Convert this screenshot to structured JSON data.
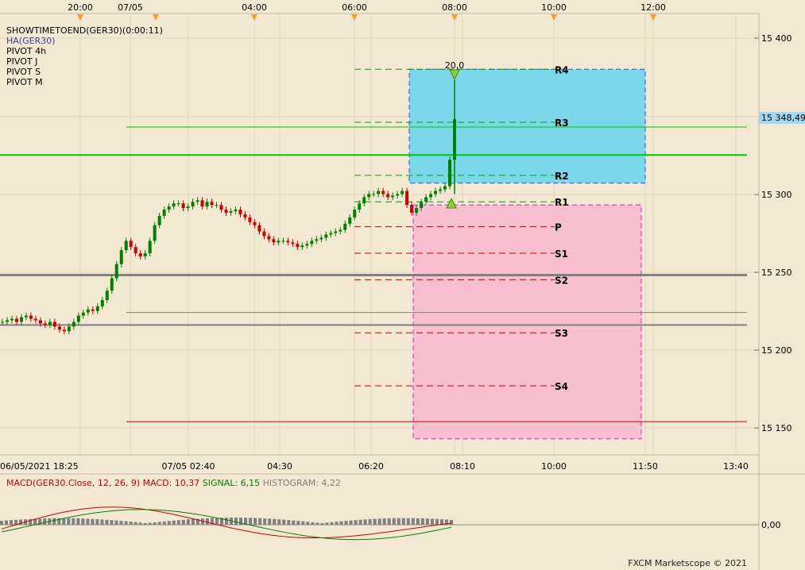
{
  "top_time_axis": {
    "labels": [
      "20:00",
      "07/05",
      "04:00",
      "06:00",
      "08:00",
      "10:00",
      "12:00"
    ]
  },
  "indicators": {
    "items": [
      {
        "label": "SHOWTIMETOEND(GER30)(0:00:11)",
        "color": "#000000"
      },
      {
        "label": "HA(GER30)",
        "color": "#3a3aa0"
      },
      {
        "label": "PIVOT 4h",
        "color": "#000000"
      },
      {
        "label": "PIVOT J",
        "color": "#000000"
      },
      {
        "label": "PIVOT S",
        "color": "#000000"
      },
      {
        "label": "PIVOT M",
        "color": "#000000"
      }
    ]
  },
  "price_axis": {
    "ticks": [
      "15 400",
      "15 300",
      "15 250",
      "15 200",
      "15 150"
    ],
    "current_price": "15 348,49",
    "current_price_bg": "#9fd8f0"
  },
  "bottom_time_axis": {
    "labels": [
      "06/05/2021 18:25",
      "07/05 02:40",
      "04:30",
      "06:20",
      "08:10",
      "10:00",
      "11:50",
      "13:40"
    ]
  },
  "pivot_labels": [
    "R4",
    "R3",
    "R2",
    "R1",
    "P",
    "S1",
    "S2",
    "S3",
    "S4"
  ],
  "signal_label": "20,0",
  "macd": {
    "title": "MACD(GER30.Close, 12, 26, 9)",
    "macd_label": "MACD: 10,37",
    "signal_label": "SIGNAL: 6,15",
    "histogram_label": "HISTOGRAM: 4,22",
    "zero_tick": "0,00",
    "colors": {
      "macd": "#cc0000",
      "signal": "#008000",
      "histogram": "#808080"
    }
  },
  "credit": "FXCM Marketscope © 2021",
  "chart_data": {
    "type": "candlestick",
    "symbol": "GER30",
    "ylim": [
      15137,
      15423
    ],
    "pivots": {
      "R4": 15380,
      "R3": 15346,
      "R2": 15312,
      "R1": 15295,
      "P": 15279,
      "S1": 15262,
      "S2": 15245,
      "S3": 15211,
      "S4": 15177
    },
    "horizontal_levels": [
      {
        "value": 15343,
        "color": "#00cc00"
      },
      {
        "value": 15325,
        "color": "#00cc00"
      },
      {
        "value": 15248,
        "color": "#808080"
      },
      {
        "value": 15224,
        "color": "#808080"
      },
      {
        "value": 15216,
        "color": "#808080"
      },
      {
        "value": 15154,
        "color": "#cc0000"
      }
    ],
    "closes": [
      15218,
      15219,
      15220,
      15218,
      15221,
      15222,
      15220,
      15219,
      15217,
      15216,
      15218,
      15215,
      15213,
      15212,
      15215,
      15218,
      15222,
      15224,
      15226,
      15225,
      15228,
      15232,
      15238,
      15246,
      15255,
      15264,
      15270,
      15266,
      15262,
      15260,
      15262,
      15270,
      15280,
      15286,
      15290,
      15292,
      15294,
      15294,
      15291,
      15292,
      15295,
      15296,
      15292,
      15295,
      15293,
      15293,
      15290,
      15288,
      15289,
      15290,
      15287,
      15285,
      15282,
      15280,
      15276,
      15273,
      15271,
      15269,
      15270,
      15270,
      15269,
      15268,
      15266,
      15267,
      15268,
      15270,
      15271,
      15272,
      15274,
      15275,
      15276,
      15277,
      15281,
      15285,
      15290,
      15294,
      15298,
      15300,
      15300,
      15302,
      15300,
      15298,
      15299,
      15300,
      15302,
      15293,
      15288,
      15291,
      15295,
      15298,
      15300,
      15302,
      15303,
      15305,
      15322,
      15348
    ],
    "boxes": [
      {
        "name": "buy-zone",
        "top": 15380,
        "bottom": 15307,
        "color": "#7bd8ea"
      },
      {
        "name": "sell-zone",
        "top": 15293,
        "bottom": 15143,
        "color": "#f7bfd0"
      }
    ]
  }
}
